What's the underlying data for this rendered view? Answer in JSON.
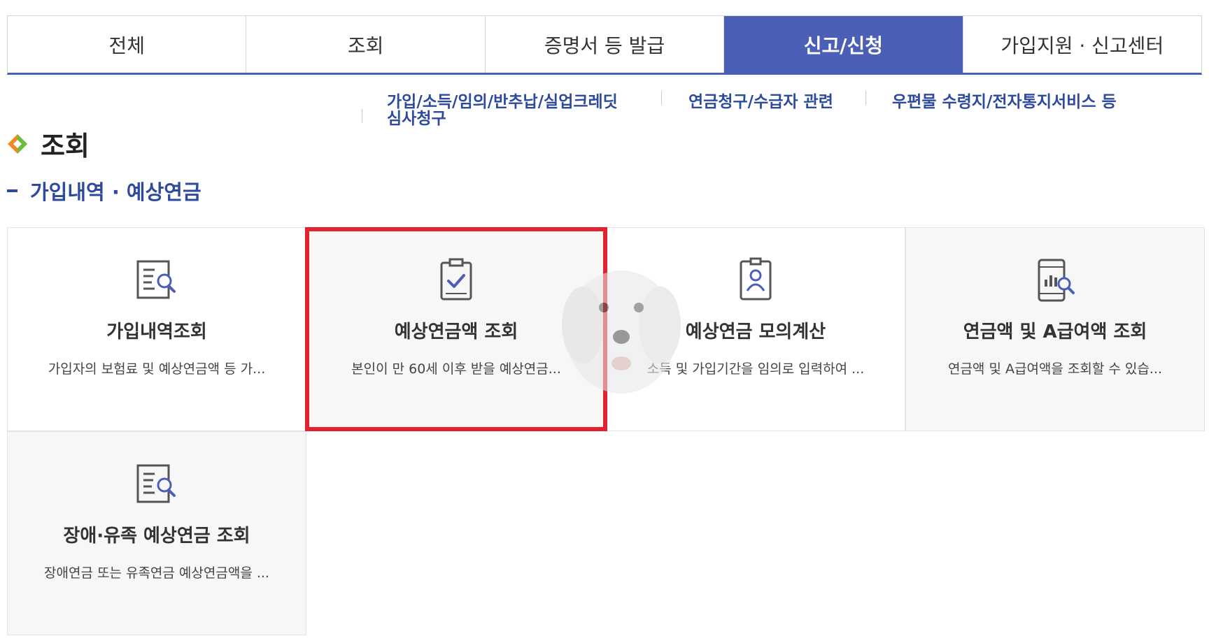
{
  "tabs": [
    "전체",
    "조회",
    "증명서 등 발급",
    "신고/신청",
    "가입지원 · 신고센터"
  ],
  "sublinks": [
    "가입/소득/임의/반추납/실업크레딧",
    "연금청구/수급자 관련",
    "우편물 수령지/전자통지서비스 등",
    "심사청구"
  ],
  "page_title": "조회",
  "section_title": "가입내역 · 예상연금",
  "cards": [
    {
      "title": "가입내역조회",
      "desc": "가입자의 보험료 및 예상연금액 등 가...",
      "icon": "document-search-icon"
    },
    {
      "title": "예상연금액 조회",
      "desc": "본인이 만 60세 이후 받을 예상연금...",
      "icon": "clipboard-check-icon"
    },
    {
      "title": "예상연금 모의계산",
      "desc": "소득 및 가입기간을 임의로 입력하여 ...",
      "icon": "id-card-person-icon"
    },
    {
      "title": "연금액 및 A급여액 조회",
      "desc": "연금액 및 A급여액을 조회할 수 있습...",
      "icon": "phone-chart-search-icon"
    },
    {
      "title": "장애·유족 예상연금 조회",
      "desc": "장애연금 또는 유족연금 예상연금액을 ...",
      "icon": "document-search-icon"
    }
  ],
  "colors": {
    "accent": "#4a5fb5",
    "link": "#2e4a9e",
    "highlight": "#e1222f",
    "diamond_orange": "#f08a24",
    "diamond_green": "#6cbf3c"
  }
}
